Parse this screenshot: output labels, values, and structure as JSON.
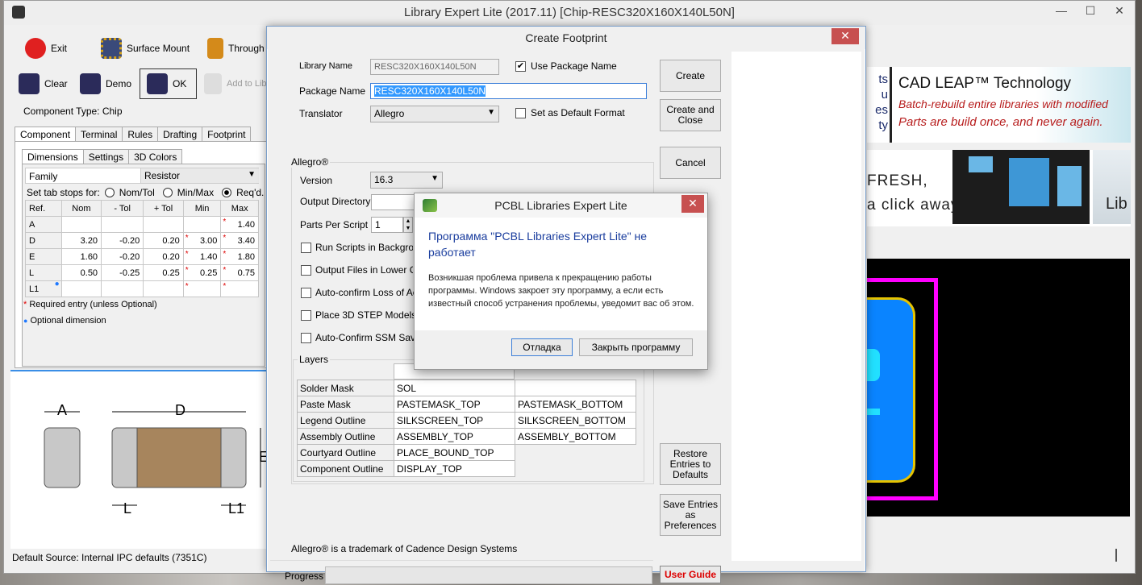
{
  "app": {
    "title": "Library Expert Lite (2017.11) [Chip-RESC320X160X140L50N]",
    "minimize": "—",
    "maximize": "☐",
    "close": "✕"
  },
  "toolbar": {
    "exit": "Exit",
    "surface_mount": "Surface Mount",
    "through": "Through",
    "clear": "Clear",
    "demo": "Demo",
    "ok": "OK",
    "add_to_lib": "Add to Lib"
  },
  "component_type": "Component Type: Chip",
  "main_tabs": [
    "Component",
    "Terminal",
    "Rules",
    "Drafting",
    "Footprint"
  ],
  "sub_tabs": [
    "Dimensions",
    "Settings",
    "3D Colors"
  ],
  "family": {
    "label": "Family",
    "value": "Resistor"
  },
  "tabstops": {
    "label": "Set tab stops for:",
    "options": [
      "Nom/Tol",
      "Min/Max",
      "Req'd."
    ],
    "selected": "Req'd."
  },
  "dim_table": {
    "headers": [
      "Ref.",
      "Nom",
      "- Tol",
      "+ Tol",
      "Min",
      "Max"
    ],
    "rows": [
      [
        "A",
        "",
        "",
        "",
        "",
        "1.40"
      ],
      [
        "D",
        "3.20",
        "-0.20",
        "0.20",
        "3.00",
        "3.40"
      ],
      [
        "E",
        "1.60",
        "-0.20",
        "0.20",
        "1.40",
        "1.80"
      ],
      [
        "L",
        "0.50",
        "-0.25",
        "0.25",
        "0.25",
        "0.75"
      ],
      [
        "L1",
        "",
        "",
        "",
        "",
        ""
      ]
    ]
  },
  "legend": {
    "required": "Required entry (unless Optional)",
    "optional": "Optional dimension"
  },
  "drawing_labels": {
    "a": "A",
    "d": "D",
    "e": "E",
    "l": "L",
    "l1": "L1"
  },
  "status": {
    "default_source": "Default Source:  Internal IPC defaults (7351C)"
  },
  "ads": {
    "cad_leap_title": "CAD LEAP™ Technology",
    "cad_leap_line1": "Batch-rebuild entire libraries with modified",
    "cad_leap_line2": "Parts are build once, and never again.",
    "partial_left": [
      "ts",
      "u",
      "es",
      "ty"
    ],
    "fresh_line1": "FRESH,",
    "fresh_line2": "a click away.",
    "lib_partial": "Lib"
  },
  "dialog": {
    "title": "Create Footprint",
    "close": "✕",
    "library_name_label": "Library Name",
    "library_name": "RESC320X160X140L50N",
    "use_package_name": "Use Package Name",
    "package_name_label": "Package Name",
    "package_name": "RESC320X160X140L50N",
    "translator_label": "Translator",
    "translator": "Allegro",
    "set_default_format": "Set as Default Format",
    "allegro_group": "Allegro®",
    "version_label": "Version",
    "version": "16.3",
    "output_dir_label": "Output Directory",
    "output_dir": "",
    "browse": "...",
    "parts_per_script_label": "Parts Per Script",
    "parts_per_script": "1",
    "options": [
      "Run Scripts in Background",
      "Output Files in Lower Case",
      "Auto-confirm Loss of Accu",
      "Place 3D STEP Models v",
      "Auto-Confirm SSM Save"
    ],
    "layers_group": "Layers",
    "layers": [
      {
        "name": "Solder Mask",
        "top": "SOL",
        "bottom": ""
      },
      {
        "name": "Paste Mask",
        "top": "PASTEMASK_TOP",
        "bottom": "PASTEMASK_BOTTOM"
      },
      {
        "name": "Legend Outline",
        "top": "SILKSCREEN_TOP",
        "bottom": "SILKSCREEN_BOTTOM"
      },
      {
        "name": "Assembly Outline",
        "top": "ASSEMBLY_TOP",
        "bottom": "ASSEMBLY_BOTTOM"
      },
      {
        "name": "Courtyard Outline",
        "top": "PLACE_BOUND_TOP",
        "bottom": ""
      },
      {
        "name": "Component Outline",
        "top": "DISPLAY_TOP",
        "bottom": ""
      }
    ],
    "trademark": "Allegro® is a trademark of Cadence Design Systems",
    "progress_label": "Progress",
    "buttons": {
      "create": "Create",
      "create_close": "Create and Close",
      "cancel": "Cancel",
      "restore": "Restore Entries to Defaults",
      "save_prefs": "Save Entries as Preferences",
      "user_guide": "User Guide"
    }
  },
  "error_dialog": {
    "title": "PCBL Libraries Expert Lite",
    "close": "✕",
    "heading": "Программа \"PCBL Libraries Expert Lite\" не работает",
    "message": "Возникшая проблема привела к прекращению работы программы. Windows закроет эту программу, а если есть известный способ устранения проблемы, уведомит вас об этом.",
    "debug_button": "Отладка",
    "close_button": "Закрыть программу"
  },
  "colors": {
    "accent": "#0078d7",
    "close_red": "#c75050",
    "pcb_black": "#000000",
    "pad_blue": "#0a84ff",
    "courtyard_magenta": "#ff00ff",
    "ad_red": "#b71c1c"
  }
}
